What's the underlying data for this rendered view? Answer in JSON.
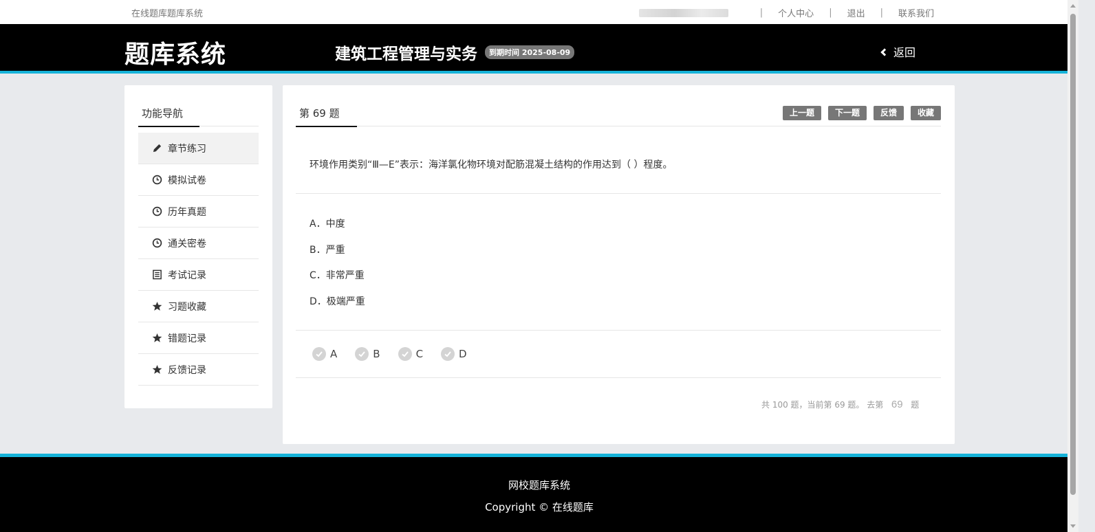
{
  "topbar": {
    "site_name": "在线题库题库系统",
    "links": [
      "个人中心",
      "退出",
      "联系我们"
    ],
    "separator": "|"
  },
  "header": {
    "brand": "题库系统",
    "course_title": "建筑工程管理与实务",
    "expiry_badge": "到期时间 2025-08-09",
    "back_label": "返回"
  },
  "sidebar": {
    "title": "功能导航",
    "items": [
      {
        "label": "章节练习",
        "icon": "pencil-icon"
      },
      {
        "label": "模拟试卷",
        "icon": "clock-icon"
      },
      {
        "label": "历年真题",
        "icon": "clock-icon"
      },
      {
        "label": "通关密卷",
        "icon": "clock-icon"
      },
      {
        "label": "考试记录",
        "icon": "list-icon"
      },
      {
        "label": "习题收藏",
        "icon": "star-icon"
      },
      {
        "label": "错题记录",
        "icon": "star-icon"
      },
      {
        "label": "反馈记录",
        "icon": "star-icon"
      }
    ]
  },
  "question": {
    "number_label": "第 69 题",
    "buttons": {
      "prev": "上一题",
      "next": "下一题",
      "feedback": "反馈",
      "favorite": "收藏"
    },
    "text": "环境作用类别“Ⅲ—E”表示：海洋氯化物环境对配筋混凝土结构的作用达到（ ）程度。",
    "options": [
      "A．中度",
      "B．严重",
      "C．非常严重",
      "D．极端严重"
    ],
    "answer_choices": [
      "A",
      "B",
      "C",
      "D"
    ],
    "pager": {
      "summary": "共 100 题，当前第 69 题。 去第",
      "current": "69",
      "suffix": "题"
    }
  },
  "footer": {
    "line1": "网校题库系统",
    "line2": "Copyright © 在线题库"
  },
  "colors": {
    "accent": "#16b3d9",
    "header_bg": "#000000",
    "button_bg": "#777777"
  }
}
